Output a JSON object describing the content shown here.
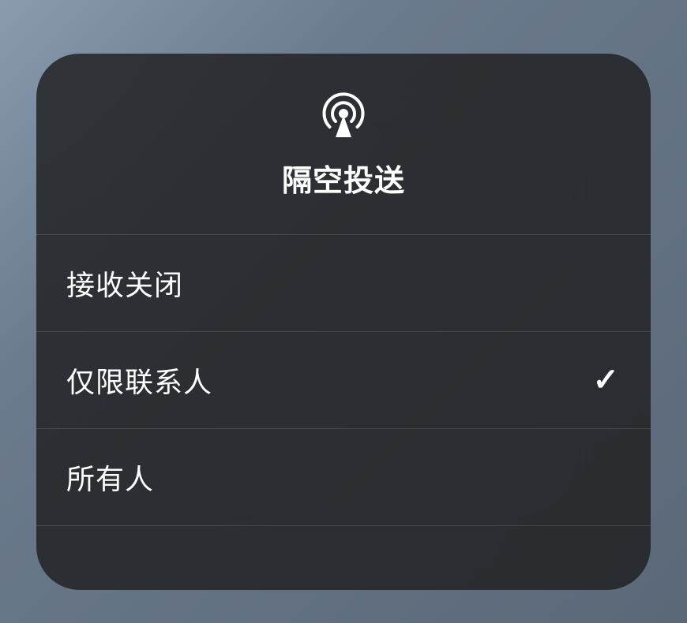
{
  "panel": {
    "title": "隔空投送",
    "icon_name": "airdrop-icon"
  },
  "options": [
    {
      "label": "接收关闭",
      "selected": false
    },
    {
      "label": "仅限联系人",
      "selected": true
    },
    {
      "label": "所有人",
      "selected": false
    }
  ]
}
